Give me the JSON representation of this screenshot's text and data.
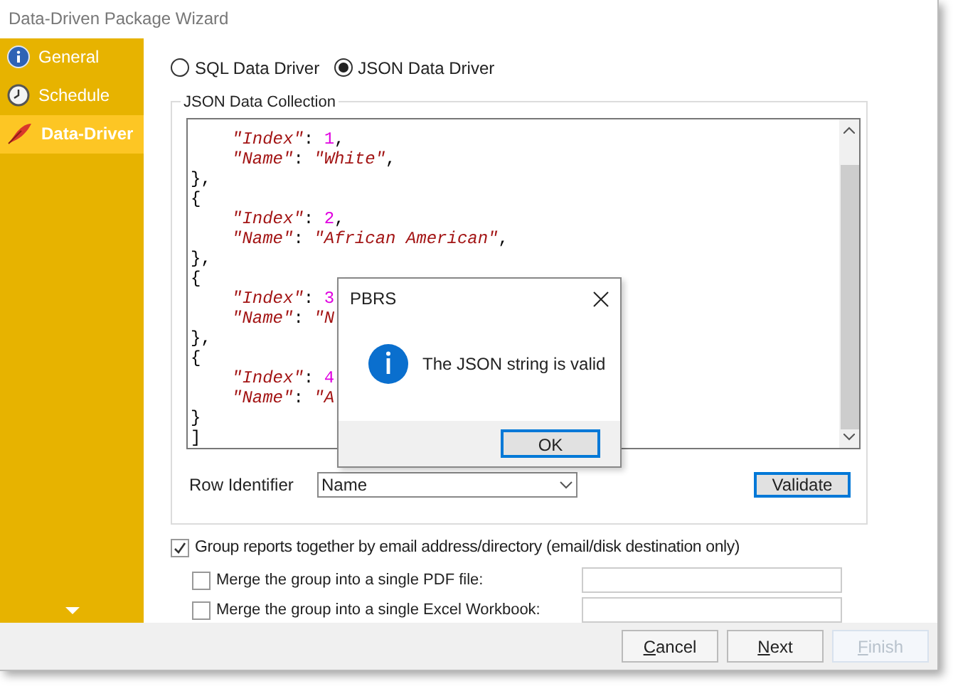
{
  "window": {
    "title": "Data-Driven Package Wizard"
  },
  "sidebar": {
    "items": [
      {
        "label": "General",
        "kind": "info",
        "selected": false
      },
      {
        "label": "Schedule",
        "kind": "clock",
        "selected": false
      },
      {
        "label": "Data-Driver",
        "kind": "quill",
        "selected": true
      }
    ]
  },
  "drivers": [
    {
      "label": "SQL Data Driver",
      "selected": false
    },
    {
      "label": "JSON Data Driver",
      "selected": true
    }
  ],
  "json_collection": {
    "title": "JSON Data Collection",
    "lines": [
      {
        "children": [
          {
            "tokens": [
              {
                "kind": "key",
                "text": "\"Index\""
              },
              {
                "kind": "punct",
                "text": ": "
              },
              {
                "kind": "number",
                "text": "1"
              },
              {
                "kind": "punct",
                "text": ","
              }
            ]
          },
          {
            "tokens": [
              {
                "kind": "key",
                "text": "\"Name\""
              },
              {
                "kind": "punct",
                "text": ": "
              },
              {
                "kind": "string",
                "text": "\"White\""
              },
              {
                "kind": "punct",
                "text": ","
              }
            ]
          }
        ]
      },
      {
        "tokens": [
          {
            "kind": "punct",
            "text": "},"
          }
        ]
      },
      {
        "tokens": [
          {
            "kind": "punct",
            "text": "{"
          }
        ]
      },
      {
        "children": [
          {
            "tokens": [
              {
                "kind": "key",
                "text": "\"Index\""
              },
              {
                "kind": "punct",
                "text": ": "
              },
              {
                "kind": "number",
                "text": "2"
              },
              {
                "kind": "punct",
                "text": ","
              }
            ]
          },
          {
            "tokens": [
              {
                "kind": "key",
                "text": "\"Name\""
              },
              {
                "kind": "punct",
                "text": ": "
              },
              {
                "kind": "string",
                "text": "\"African American\""
              },
              {
                "kind": "punct",
                "text": ","
              }
            ]
          }
        ]
      },
      {
        "tokens": [
          {
            "kind": "punct",
            "text": "},"
          }
        ]
      },
      {
        "tokens": [
          {
            "kind": "punct",
            "text": "{"
          }
        ]
      },
      {
        "children": [
          {
            "tokens": [
              {
                "kind": "key",
                "text": "\"Index\""
              },
              {
                "kind": "punct",
                "text": ": "
              },
              {
                "kind": "number",
                "text": "3"
              }
            ]
          },
          {
            "tokens": [
              {
                "kind": "key",
                "text": "\"Name\""
              },
              {
                "kind": "punct",
                "text": ": "
              },
              {
                "kind": "string",
                "text": "\"N"
              }
            ]
          }
        ]
      },
      {
        "tokens": [
          {
            "kind": "punct",
            "text": "},"
          }
        ]
      },
      {
        "tokens": [
          {
            "kind": "punct",
            "text": "{"
          }
        ]
      },
      {
        "children": [
          {
            "tokens": [
              {
                "kind": "key",
                "text": "\"Index\""
              },
              {
                "kind": "punct",
                "text": ": "
              },
              {
                "kind": "number",
                "text": "4"
              }
            ]
          },
          {
            "tokens": [
              {
                "kind": "key",
                "text": "\"Name\""
              },
              {
                "kind": "punct",
                "text": ": "
              },
              {
                "kind": "string",
                "text": "\"A"
              }
            ]
          }
        ]
      },
      {
        "tokens": [
          {
            "kind": "punct",
            "text": "}"
          }
        ]
      },
      {
        "tokens": [
          {
            "kind": "punct",
            "text": "]"
          }
        ]
      }
    ]
  },
  "row_identifier": {
    "label": "Row Identifier",
    "value": "Name"
  },
  "validate_button": "Validate",
  "group_option": {
    "label": "Group reports together by email address/directory (email/disk destination only)",
    "checked": true
  },
  "merge_options": [
    {
      "label": "Merge the group into a single PDF file:",
      "checked": false
    },
    {
      "label": "Merge the group into a single Excel Workbook:",
      "checked": false
    }
  ],
  "buttons": [
    {
      "label": "Cancel",
      "disabled": false
    },
    {
      "label": "Next",
      "disabled": false
    },
    {
      "label": "Finish",
      "disabled": true
    }
  ],
  "dialog": {
    "title": "PBRS",
    "message": "The JSON string is valid",
    "button": "OK"
  }
}
